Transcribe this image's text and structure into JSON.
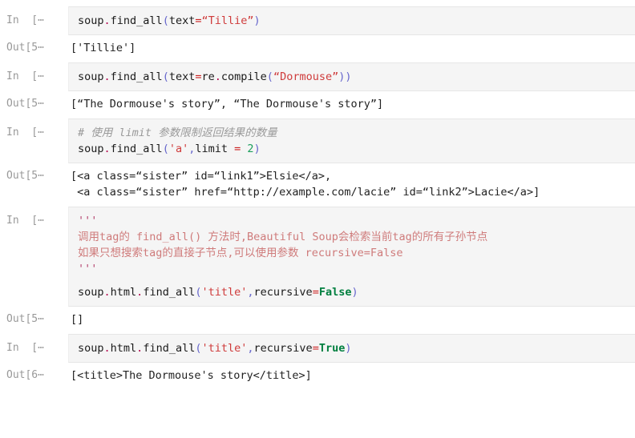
{
  "app": {
    "type": "jupyter-notebook",
    "background": "#ffffff"
  },
  "colors": {
    "input_cell_bg": "#f5f5f5",
    "prompt_text": "#999999",
    "string": "#cf3b3b",
    "keyword": "#007f3f",
    "number": "#1a9e5c",
    "comment": "#9a9a9a",
    "docstring": "#cf7b7b",
    "operator": "#cc2222",
    "punctuation": "#6666cc",
    "dot": "#b4004e"
  },
  "cells": [
    {
      "kind": "input",
      "prompt": "In  [⋯",
      "lines": [
        [
          {
            "t": "soup",
            "c": "t-name"
          },
          {
            "t": ".",
            "c": "t-dot"
          },
          {
            "t": "find_all",
            "c": "t-name"
          },
          {
            "t": "(",
            "c": "t-punct"
          },
          {
            "t": "text",
            "c": "t-name"
          },
          {
            "t": "=",
            "c": "t-op"
          },
          {
            "t": "“Tillie”",
            "c": "t-str"
          },
          {
            "t": ")",
            "c": "t-punct"
          }
        ]
      ]
    },
    {
      "kind": "output",
      "prompt": "Out[5⋯",
      "lines": [
        "['Tillie']"
      ]
    },
    {
      "kind": "input",
      "prompt": "In  [⋯",
      "lines": [
        [
          {
            "t": "soup",
            "c": "t-name"
          },
          {
            "t": ".",
            "c": "t-dot"
          },
          {
            "t": "find_all",
            "c": "t-name"
          },
          {
            "t": "(",
            "c": "t-punct"
          },
          {
            "t": "text",
            "c": "t-name"
          },
          {
            "t": "=",
            "c": "t-op"
          },
          {
            "t": "re",
            "c": "t-name"
          },
          {
            "t": ".",
            "c": "t-dot"
          },
          {
            "t": "compile",
            "c": "t-name"
          },
          {
            "t": "(",
            "c": "t-punct"
          },
          {
            "t": "“Dormouse”",
            "c": "t-str"
          },
          {
            "t": "))",
            "c": "t-punct"
          }
        ]
      ]
    },
    {
      "kind": "output",
      "prompt": "Out[5⋯",
      "lines": [
        "[“The Dormouse's story”, “The Dormouse's story”]"
      ]
    },
    {
      "kind": "input",
      "prompt": "In  [⋯",
      "lines": [
        [
          {
            "t": "# 使用 limit 参数限制返回结果的数量",
            "c": "t-comment"
          }
        ],
        [
          {
            "t": "soup",
            "c": "t-name"
          },
          {
            "t": ".",
            "c": "t-dot"
          },
          {
            "t": "find_all",
            "c": "t-name"
          },
          {
            "t": "(",
            "c": "t-punct"
          },
          {
            "t": "'a'",
            "c": "t-str"
          },
          {
            "t": ",",
            "c": "t-punct"
          },
          {
            "t": "limit ",
            "c": "t-name"
          },
          {
            "t": "=",
            "c": "t-op"
          },
          {
            "t": " ",
            "c": "t-name"
          },
          {
            "t": "2",
            "c": "t-num"
          },
          {
            "t": ")",
            "c": "t-punct"
          }
        ]
      ]
    },
    {
      "kind": "output",
      "prompt": "Out[5⋯",
      "lines": [
        "[<a class=“sister” id=“link1”>Elsie</a>,",
        " <a class=“sister” href=“http://example.com/lacie” id=“link2”>Lacie</a>]"
      ]
    },
    {
      "kind": "input",
      "prompt": "In  [⋯",
      "lines": [
        [
          {
            "t": "'''",
            "c": "t-docq"
          }
        ],
        [
          {
            "t": "调用tag的 find_all() 方法时,Beautiful Soup会检索当前tag的所有子孙节点",
            "c": "t-doc"
          }
        ],
        [
          {
            "t": "如果只想搜索tag的直接子节点,可以使用参数 recursive=False",
            "c": "t-doc"
          }
        ],
        [
          {
            "t": "'''",
            "c": "t-docq"
          }
        ],
        "__blank__",
        [
          {
            "t": "soup",
            "c": "t-name"
          },
          {
            "t": ".",
            "c": "t-dot"
          },
          {
            "t": "html",
            "c": "t-name"
          },
          {
            "t": ".",
            "c": "t-dot"
          },
          {
            "t": "find_all",
            "c": "t-name"
          },
          {
            "t": "(",
            "c": "t-punct"
          },
          {
            "t": "'title'",
            "c": "t-str"
          },
          {
            "t": ",",
            "c": "t-punct"
          },
          {
            "t": "recursive",
            "c": "t-name"
          },
          {
            "t": "=",
            "c": "t-op"
          },
          {
            "t": "False",
            "c": "t-kw"
          },
          {
            "t": ")",
            "c": "t-punct"
          }
        ]
      ]
    },
    {
      "kind": "output",
      "prompt": "Out[5⋯",
      "lines": [
        "[]"
      ]
    },
    {
      "kind": "input",
      "prompt": "In  [⋯",
      "lines": [
        [
          {
            "t": "soup",
            "c": "t-name"
          },
          {
            "t": ".",
            "c": "t-dot"
          },
          {
            "t": "html",
            "c": "t-name"
          },
          {
            "t": ".",
            "c": "t-dot"
          },
          {
            "t": "find_all",
            "c": "t-name"
          },
          {
            "t": "(",
            "c": "t-punct"
          },
          {
            "t": "'title'",
            "c": "t-str"
          },
          {
            "t": ",",
            "c": "t-punct"
          },
          {
            "t": "recursive",
            "c": "t-name"
          },
          {
            "t": "=",
            "c": "t-op"
          },
          {
            "t": "True",
            "c": "t-kw"
          },
          {
            "t": ")",
            "c": "t-punct"
          }
        ]
      ]
    },
    {
      "kind": "output",
      "prompt": "Out[6⋯",
      "lines": [
        "[<title>The Dormouse's story</title>]"
      ]
    }
  ]
}
